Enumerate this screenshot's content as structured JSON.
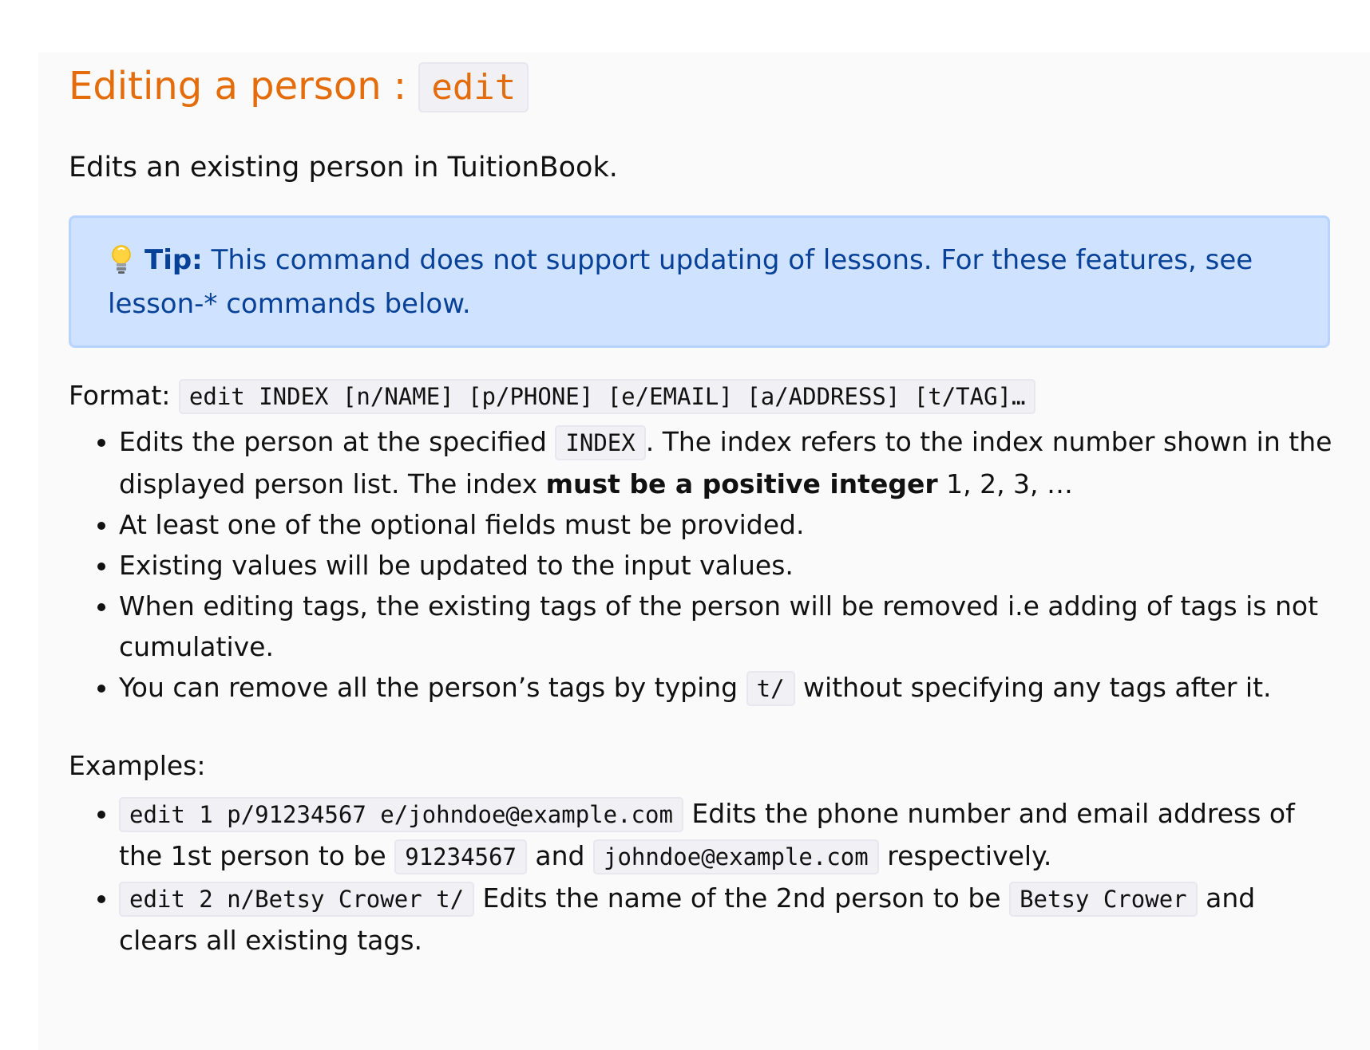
{
  "heading": {
    "text": "Editing a person : ",
    "code": "edit"
  },
  "intro": "Edits an existing person in TuitionBook.",
  "tip": {
    "icon": "lightbulb-icon",
    "label": "Tip:",
    "text": " This command does not support updating of lessons. For these features, see lesson-* commands below."
  },
  "format": {
    "label": "Format: ",
    "code": "edit INDEX [n/NAME] [p/PHONE] [e/EMAIL] [a/ADDRESS] [t/TAG]…"
  },
  "rules": {
    "r1": {
      "pre": "Edits the person at the specified ",
      "code": "INDEX",
      "mid": ". The index refers to the index number shown in the displayed person list. The index ",
      "bold": "must be a positive integer",
      "post": " 1, 2, 3, …"
    },
    "r2": "At least one of the optional fields must be provided.",
    "r3": "Existing values will be updated to the input values.",
    "r4": "When editing tags, the existing tags of the person will be removed i.e adding of tags is not cumulative.",
    "r5": {
      "pre": "You can remove all the person’s tags by typing ",
      "code": "t/",
      "post": " without specifying any tags after it."
    }
  },
  "examples_label": "Examples:",
  "examples": {
    "e1": {
      "code1": "edit 1 p/91234567 e/johndoe@example.com",
      "text1": " Edits the phone number and email address of the 1st person to be ",
      "code2": "91234567",
      "text2": " and ",
      "code3": "johndoe@example.com",
      "text3": " respectively."
    },
    "e2": {
      "code1": "edit 2 n/Betsy Crower t/",
      "text1": " Edits the name of the 2nd person to be ",
      "code2": "Betsy Crower",
      "text2": " and clears all existing tags."
    }
  },
  "colors": {
    "heading": "#e46c0a",
    "tip_bg": "#cfe2ff",
    "tip_border": "#b6d4fe",
    "tip_text": "#084298",
    "code_bg": "#f1f1f5"
  }
}
